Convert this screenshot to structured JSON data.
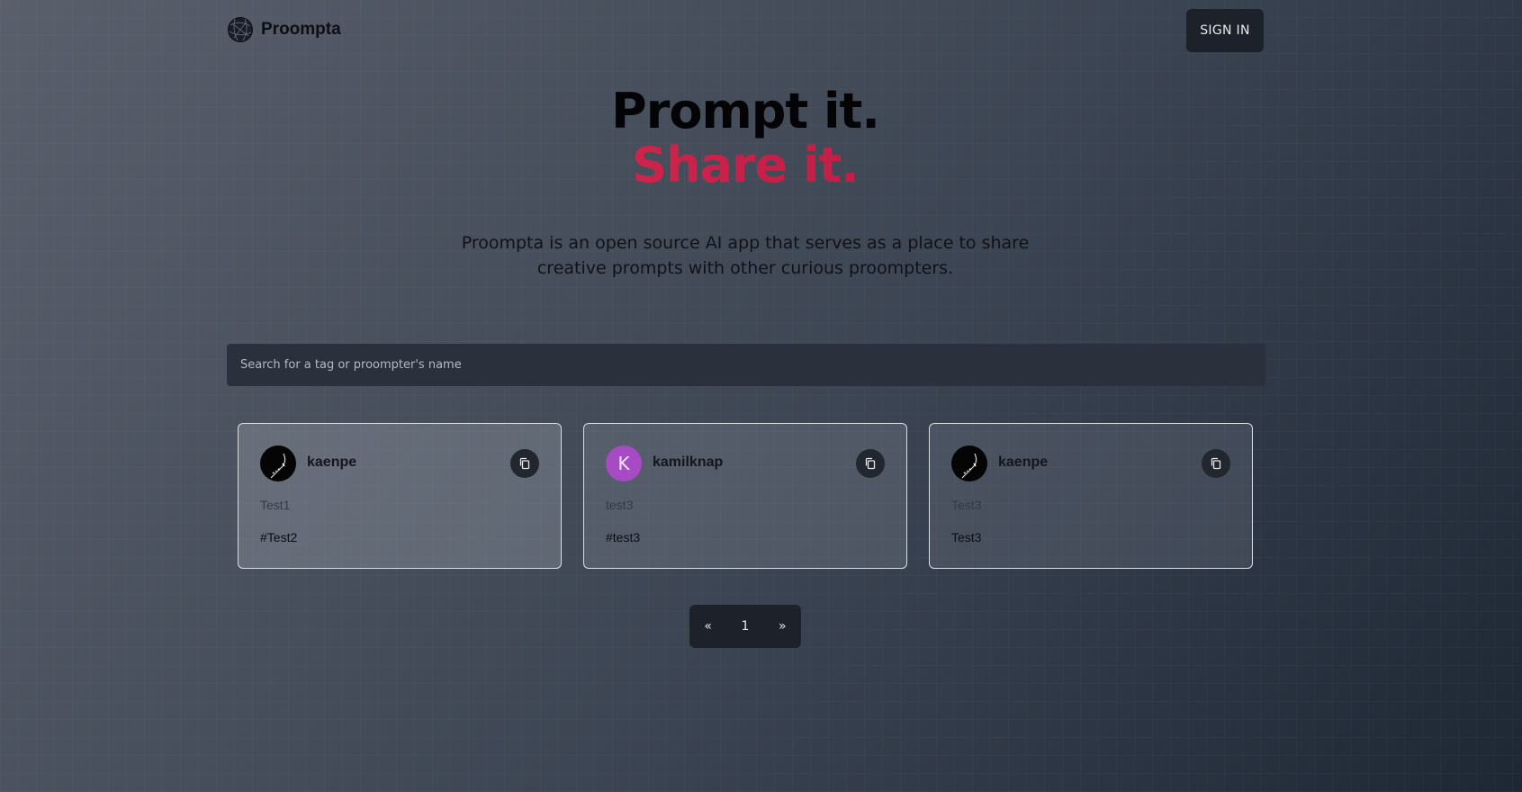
{
  "header": {
    "brand_name": "Proompta",
    "sign_in_label": "SIGN IN"
  },
  "hero": {
    "line1": "Prompt it.",
    "line2": "Share it.",
    "description": "Proompta is an open source AI app that serves as a place to share creative prompts with other curious proompters."
  },
  "search": {
    "placeholder": "Search for a tag or proompter's name",
    "value": ""
  },
  "cards": [
    {
      "username": "kaenpe",
      "avatar": "dark-abstract-avatar",
      "prompt": "Test1",
      "tag": "#Test2"
    },
    {
      "username": "kamilknap",
      "avatar": "letter-avatar",
      "avatar_letter": "K",
      "prompt": "test3",
      "tag": "#test3"
    },
    {
      "username": "kaenpe",
      "avatar": "dark-abstract-avatar",
      "prompt": "Test3",
      "tag": "Test3"
    }
  ],
  "pagination": {
    "prev_label": "«",
    "current_page": "1",
    "next_label": "»"
  },
  "icons": {
    "logo": "globe-network-icon",
    "copy": "copy-icon"
  },
  "colors": {
    "accent_gradient_start": "#e8345a",
    "accent_gradient_end": "#a31538",
    "button_dark": "#1d2129",
    "letter_avatar": "#a64bc4"
  }
}
